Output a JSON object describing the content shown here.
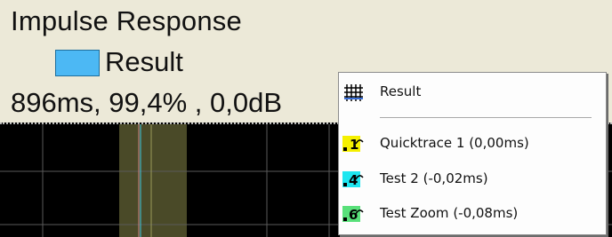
{
  "header": {
    "title": "Impulse Response",
    "legend_label": "Result",
    "legend_color": "#4cb8f4",
    "readout": "896ms, 99,4% , 0,0dB"
  },
  "context_menu": {
    "items": [
      {
        "label": "Result",
        "icon": "grid-icon",
        "color": "#ffffff"
      },
      {
        "label": "Quicktrace 1 (0,00ms)",
        "icon": "trace-1-icon",
        "color": "#f5f000"
      },
      {
        "label": "Test 2 (-0,02ms)",
        "icon": "trace-4-icon",
        "color": "#1fe6f0"
      },
      {
        "label": "Test Zoom (-0,08ms)",
        "icon": "trace-6-icon",
        "color": "#59e07a"
      }
    ]
  }
}
